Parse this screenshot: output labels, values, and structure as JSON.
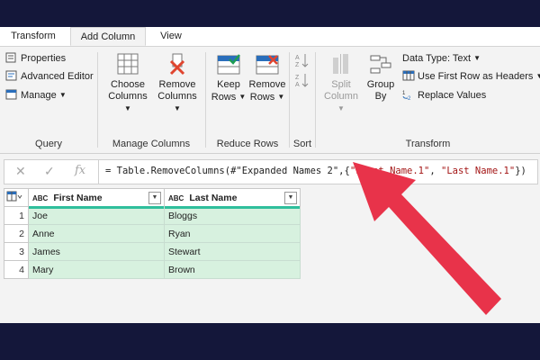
{
  "tabs": [
    {
      "label": "Transform"
    },
    {
      "label": "Add Column"
    },
    {
      "label": "View"
    }
  ],
  "ribbon": {
    "query": {
      "label": "Query",
      "properties": "Properties",
      "advanced_editor": "Advanced Editor",
      "manage": "Manage"
    },
    "manage_columns": {
      "label": "Manage Columns",
      "choose_columns": [
        "Choose",
        "Columns"
      ],
      "remove_columns": [
        "Remove",
        "Columns"
      ]
    },
    "reduce_rows": {
      "label": "Reduce Rows",
      "keep_rows": [
        "Keep",
        "Rows"
      ],
      "remove_rows": [
        "Remove",
        "Rows"
      ]
    },
    "sort": {
      "label": "Sort"
    },
    "transform": {
      "label": "Transform",
      "split_column": [
        "Split",
        "Column"
      ],
      "group_by": [
        "Group",
        "By"
      ],
      "data_type": "Data Type: Text",
      "use_first_row": "Use First Row as Headers",
      "replace_values": "Replace Values"
    }
  },
  "formula_bar": {
    "prefix": "= Table.RemoveColumns(#\"Expanded Names 2\",{",
    "arg1": "\"First Name.1\"",
    "sep": ", ",
    "arg2": "\"Last Name.1\"",
    "suffix": "})"
  },
  "table": {
    "columns": [
      "First Name",
      "Last Name"
    ],
    "type_label": "ABC",
    "rows": [
      {
        "num": "1",
        "first": "Joe",
        "last": "Bloggs"
      },
      {
        "num": "2",
        "first": "Anne",
        "last": "Ryan"
      },
      {
        "num": "3",
        "first": "James",
        "last": "Stewart"
      },
      {
        "num": "4",
        "first": "Mary",
        "last": "Brown"
      }
    ]
  },
  "colors": {
    "background": "#14173a",
    "arrow": "#e8334a",
    "header_accent": "#2fbf9c",
    "cell_fill": "#d7f1df"
  }
}
